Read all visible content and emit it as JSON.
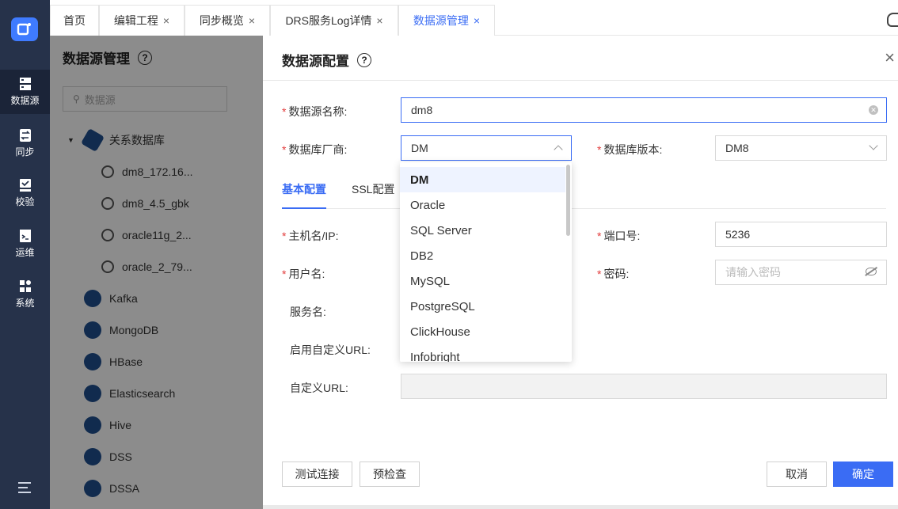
{
  "nav": {
    "items": [
      {
        "label": "数据源",
        "icon": "database-icon"
      },
      {
        "label": "同步",
        "icon": "sync-icon"
      },
      {
        "label": "校验",
        "icon": "check-icon"
      },
      {
        "label": "运维",
        "icon": "terminal-icon"
      },
      {
        "label": "系统",
        "icon": "system-icon"
      }
    ]
  },
  "tabs": [
    {
      "label": "首页",
      "closable": false
    },
    {
      "label": "编辑工程",
      "closable": true
    },
    {
      "label": "同步概览",
      "closable": true
    },
    {
      "label": "DRS服务Log详情",
      "closable": true
    },
    {
      "label": "数据源管理",
      "closable": true,
      "active": true
    }
  ],
  "close_glyph": "×",
  "help_glyph": "?",
  "background_page": {
    "title": "数据源管理",
    "search_placeholder": "数据源",
    "tree": {
      "group_label": "关系数据库",
      "leaves": [
        "dm8_172.16...",
        "dm8_4.5_gbk",
        "oracle11g_2...",
        "oracle_2_79..."
      ],
      "types": [
        "Kafka",
        "MongoDB",
        "HBase",
        "Elasticsearch",
        "Hive",
        "DSS",
        "DSSA"
      ]
    }
  },
  "drawer": {
    "title": "数据源配置",
    "name_label": "数据源名称:",
    "name_value": "dm8",
    "vendor_label": "数据库厂商:",
    "vendor_value": "DM",
    "version_label": "数据库版本:",
    "version_value": "DM8",
    "subtabs": [
      "基本配置",
      "SSL配置"
    ],
    "host_label": "主机名/IP:",
    "port_label": "端口号:",
    "port_value": "5236",
    "user_label": "用户名:",
    "password_label": "密码:",
    "password_placeholder": "请输入密码",
    "service_label": "服务名:",
    "enable_url_label": "启用自定义URL:",
    "custom_url_label": "自定义URL:",
    "buttons": {
      "test": "测试连接",
      "precheck": "预检查",
      "cancel": "取消",
      "ok": "确定"
    }
  },
  "vendor_dropdown": {
    "selected": "DM",
    "options": [
      "DM",
      "Oracle",
      "SQL Server",
      "DB2",
      "MySQL",
      "PostgreSQL",
      "ClickHouse",
      "Infobright"
    ]
  },
  "colors": {
    "accent": "#3a6cf4",
    "nav_bg": "#26324a",
    "required": "#e23b3b"
  }
}
